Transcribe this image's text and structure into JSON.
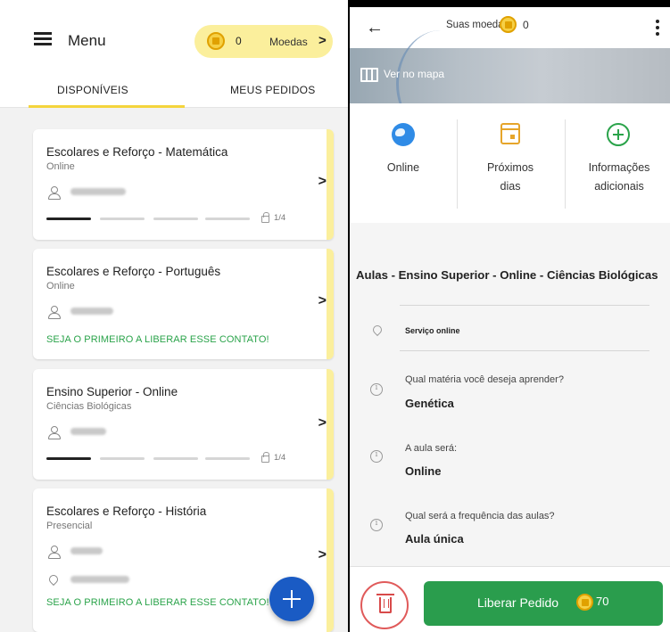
{
  "left": {
    "header": {
      "menu_label": "Menu",
      "coins_count": "0",
      "coins_label": "Moedas",
      "chevron": ">"
    },
    "tabs": [
      {
        "label": "DISPONÍVEIS",
        "active": true
      },
      {
        "label": "MEUS PEDIDOS",
        "active": false
      }
    ],
    "cards": [
      {
        "title": "Escolares e Reforço - Matemática",
        "subtitle": "Online",
        "progress": "1/4",
        "progress_fraction": 0.25
      },
      {
        "title": "Escolares e Reforço - Português",
        "subtitle": "Online",
        "cta": "SEJA O PRIMEIRO A LIBERAR ESSE CONTATO!"
      },
      {
        "title": "Ensino Superior - Online",
        "subtitle": "Ciências Biológicas",
        "progress": "1/4",
        "progress_fraction": 0.25
      },
      {
        "title": "Escolares e Reforço - História",
        "subtitle": "Presencial",
        "cta": "SEJA O PRIMEIRO A LIBERAR ESSE CONTATO!"
      }
    ],
    "card_chevron": ">"
  },
  "right": {
    "header": {
      "back": "←",
      "coins_label": "Suas moedas:",
      "coins_value": "0"
    },
    "map_label": "Ver no mapa",
    "info": [
      {
        "label": "Online",
        "icon": "globe-icon"
      },
      {
        "label": "Próximos dias",
        "icon": "calendar-icon"
      },
      {
        "label": "Informações adicionais",
        "icon": "plus-circle-icon"
      }
    ],
    "request_title": "Aulas - Ensino Superior - Online - Ciências Biológicas",
    "location": "Serviço online",
    "questions": [
      {
        "label": "Qual matéria você deseja aprender?",
        "value": "Genética"
      },
      {
        "label": "A aula será:",
        "value": "Online"
      },
      {
        "label": "Qual será a frequência das aulas?",
        "value": "Aula única"
      }
    ],
    "release_button": "Liberar Pedido",
    "release_cost": "70"
  },
  "colors": {
    "accent_yellow": "#fbef9c",
    "tab_indicator": "#f4d43c",
    "green": "#2a9d4d",
    "fab_blue": "#1a5bc4",
    "delete_red": "#e05a5a"
  }
}
